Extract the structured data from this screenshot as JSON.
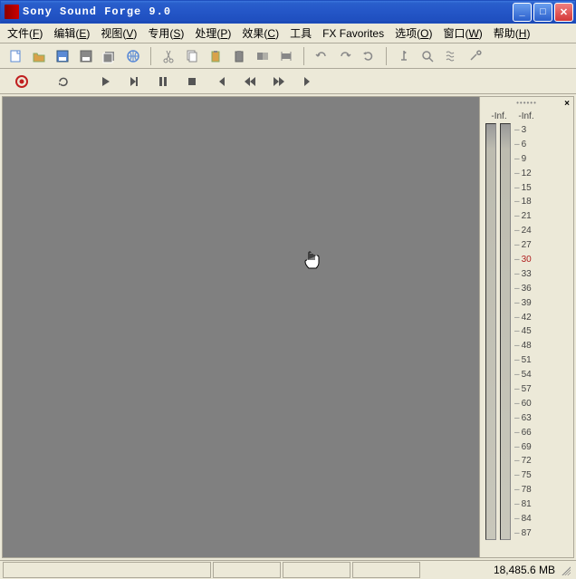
{
  "title": "Sony Sound Forge 9.0",
  "menu": [
    {
      "label": "文件(F)"
    },
    {
      "label": "编辑(E)"
    },
    {
      "label": "视图(V)"
    },
    {
      "label": "专用(S)"
    },
    {
      "label": "处理(P)"
    },
    {
      "label": "效果(C)"
    },
    {
      "label": "工具"
    },
    {
      "label": "FX Favorites"
    },
    {
      "label": "选项(O)"
    },
    {
      "label": "窗口(W)"
    },
    {
      "label": "帮助(H)"
    }
  ],
  "toolbar_icons": [
    "new-icon",
    "open-icon",
    "save-icon",
    "save-as-icon",
    "save-all-icon",
    "web-icon",
    "cut-icon",
    "copy-icon",
    "paste-icon",
    "paste-special-icon",
    "mix-icon",
    "trim-icon",
    "undo-icon",
    "redo-icon",
    "repeat-icon",
    "marker-icon",
    "zoom-icon",
    "script-icon",
    "tools-icon"
  ],
  "transport_icons": [
    "record-icon",
    "refresh-icon",
    "play-icon",
    "play-all-icon",
    "pause-icon",
    "stop-icon",
    "goto-start-icon",
    "rewind-icon",
    "forward-icon",
    "goto-end-icon"
  ],
  "meters": {
    "left_label": "-Inf.",
    "right_label": "-Inf.",
    "ticks": [
      "3",
      "6",
      "9",
      "12",
      "15",
      "18",
      "21",
      "24",
      "27",
      "30",
      "33",
      "36",
      "39",
      "42",
      "45",
      "48",
      "51",
      "54",
      "57",
      "60",
      "63",
      "66",
      "69",
      "72",
      "75",
      "78",
      "81",
      "84",
      "87"
    ],
    "hl_index": 9
  },
  "status": {
    "free_space": "18,485.6 MB"
  },
  "colors": {
    "accent": "#2A5FCC",
    "workspace": "#808080"
  }
}
